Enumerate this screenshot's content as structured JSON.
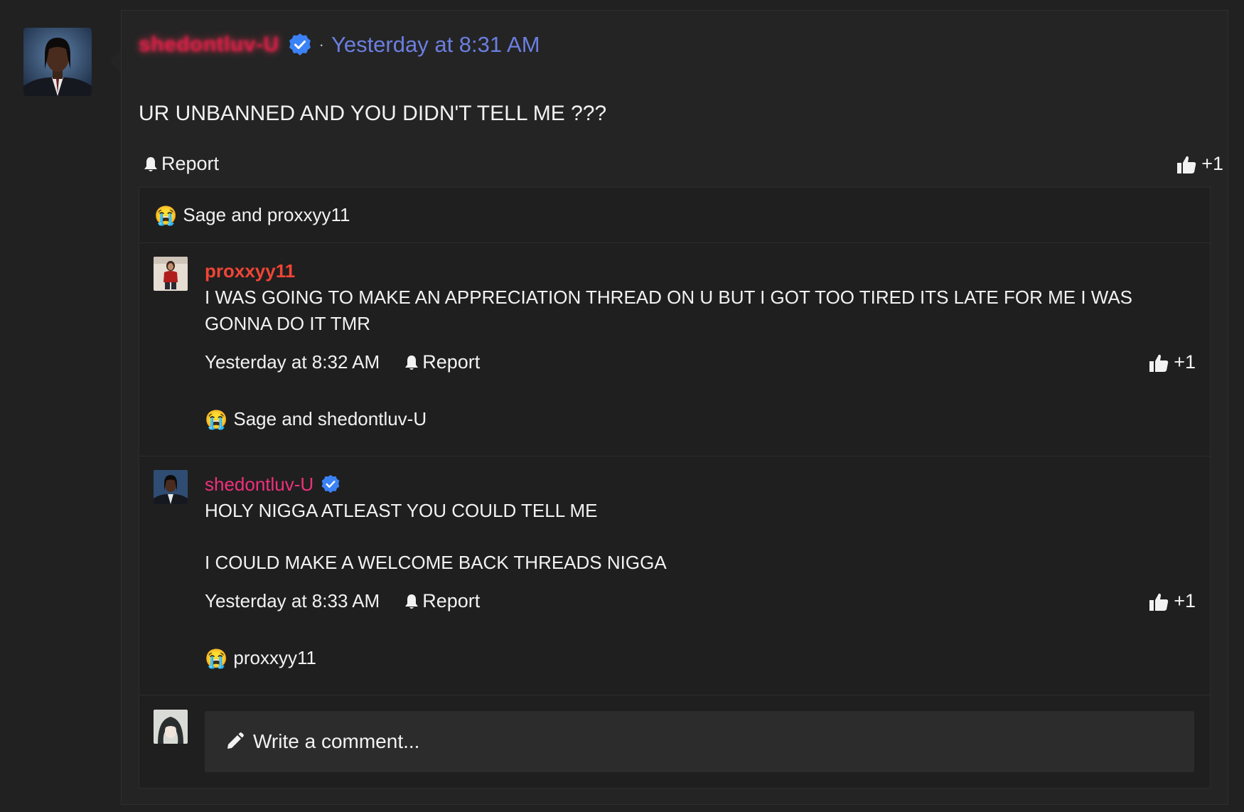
{
  "post": {
    "author": "shedontluv-U",
    "timestamp": "Yesterday at 8:31 AM",
    "separator": "·",
    "text": "UR UNBANNED AND YOU DIDN'T TELL ME ???",
    "report_label": "Report",
    "like_label": "+1",
    "reactions": {
      "emoji": "😭",
      "text": "Sage and proxxyy11"
    }
  },
  "comments": [
    {
      "author": "proxxyy11",
      "text": "I WAS GOING TO MAKE AN APPRECIATION THREAD ON U BUT I GOT TOO TIRED ITS LATE FOR ME I WAS GONNA DO IT TMR",
      "timestamp": "Yesterday at 8:32 AM",
      "report_label": "Report",
      "like_label": "+1",
      "reactions": {
        "emoji": "😭",
        "text": "Sage and shedontluv-U"
      }
    },
    {
      "author": "shedontluv-U",
      "text_line1": "HOLY NIGGA ATLEAST YOU COULD TELL ME",
      "text_line2": "I COULD MAKE A WELCOME BACK THREADS NIGGA",
      "timestamp": "Yesterday at 8:33 AM",
      "report_label": "Report",
      "like_label": "+1",
      "reactions": {
        "emoji": "😭",
        "text": "proxxyy11"
      }
    }
  ],
  "composer": {
    "placeholder": "Write a comment..."
  },
  "icons": {
    "verified": "verified-badge-icon",
    "report": "bell-icon",
    "like": "thumbs-up-icon",
    "write": "pencil-icon"
  },
  "colors": {
    "background": "#212121",
    "card": "#242424",
    "timestamp_link": "#6b7fe0",
    "verified": "#3b82f6",
    "op_name": "#e11d48",
    "proxxyy_name": "#f04535",
    "shed_name": "#f0307a"
  }
}
